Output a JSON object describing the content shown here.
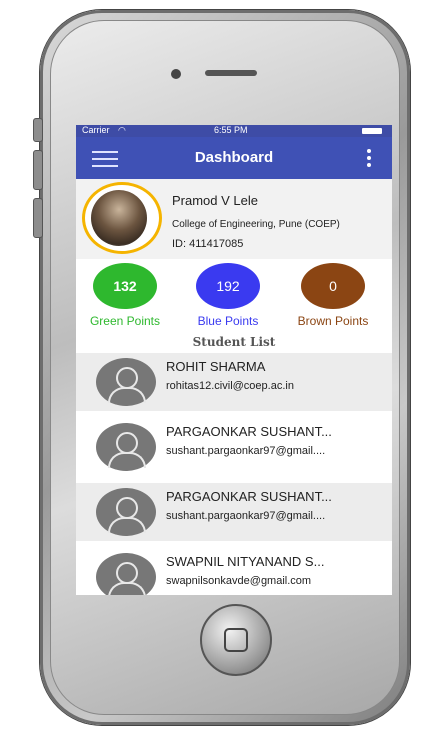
{
  "status_bar": {
    "carrier": "Carrier",
    "time": "6:55 PM"
  },
  "appbar": {
    "title": "Dashboard",
    "menu_icon": "hamburger-icon",
    "more_icon": "more-vert-icon"
  },
  "profile": {
    "name": "Pramod V Lele",
    "college": "College of Engineering, Pune (COEP)",
    "id_text": "ID:  411417085"
  },
  "points": [
    {
      "value": "132",
      "label": "Green Points",
      "color": "#2eb82e"
    },
    {
      "value": "192",
      "label": "Blue Points",
      "color": "#3a3af0"
    },
    {
      "value": "0",
      "label": "Brown Points",
      "color": "#8b4513"
    }
  ],
  "student_list_title": "Student List",
  "students": [
    {
      "name": "ROHIT SHARMA",
      "email": "rohitas12.civil@coep.ac.in"
    },
    {
      "name": "PARGAONKAR SUSHANT...",
      "email": "sushant.pargaonkar97@gmail...."
    },
    {
      "name": "PARGAONKAR SUSHANT...",
      "email": "sushant.pargaonkar97@gmail...."
    },
    {
      "name": "SWAPNIL NITYANAND S...",
      "email": "swapnilsonkavde@gmail.com"
    }
  ]
}
